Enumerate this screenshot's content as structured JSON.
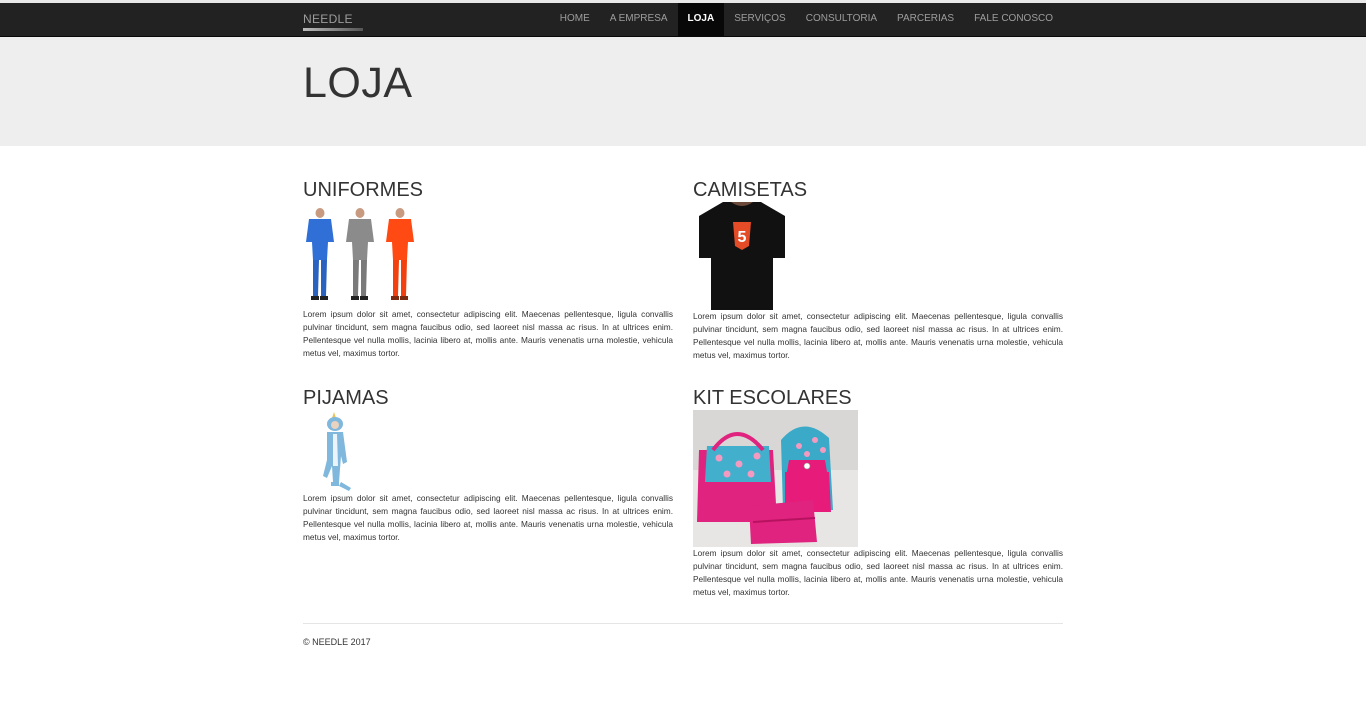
{
  "colors": {
    "navbar_bg": "#222222",
    "active_bg": "#080808",
    "jumbotron_bg": "#eeeeee"
  },
  "brand": "NEEDLE",
  "nav": [
    {
      "label": "HOME",
      "active": false
    },
    {
      "label": "A EMPRESA",
      "active": false
    },
    {
      "label": "LOJA",
      "active": true
    },
    {
      "label": "SERVIÇOS",
      "active": false
    },
    {
      "label": "CONSULTORIA",
      "active": false
    },
    {
      "label": "PARCERIAS",
      "active": false
    },
    {
      "label": "FALE CONOSCO",
      "active": false
    }
  ],
  "page": {
    "title": "LOJA"
  },
  "products": [
    {
      "title": "UNIFORMES",
      "image": "uniforms-photo",
      "text": "Lorem ipsum dolor sit amet, consectetur adipiscing elit. Maecenas pellentesque, ligula convallis pulvinar tincidunt, sem magna faucibus odio, sed laoreet nisl massa ac risus. In at ultrices enim. Pellentesque vel nulla mollis, lacinia libero at, mollis ante. Mauris venenatis urna molestie, vehicula metus vel, maximus tortor."
    },
    {
      "title": "CAMISETAS",
      "image": "tshirt-photo",
      "text": "Lorem ipsum dolor sit amet, consectetur adipiscing elit. Maecenas pellentesque, ligula convallis pulvinar tincidunt, sem magna faucibus odio, sed laoreet nisl massa ac risus. In at ultrices enim. Pellentesque vel nulla mollis, lacinia libero at, mollis ante. Mauris venenatis urna molestie, vehicula metus vel, maximus tortor."
    },
    {
      "title": "PIJAMAS",
      "image": "pajama-photo",
      "text": "Lorem ipsum dolor sit amet, consectetur adipiscing elit. Maecenas pellentesque, ligula convallis pulvinar tincidunt, sem magna faucibus odio, sed laoreet nisl massa ac risus. In at ultrices enim. Pellentesque vel nulla mollis, lacinia libero at, mollis ante. Mauris venenatis urna molestie, vehicula metus vel, maximus tortor."
    },
    {
      "title": "KIT ESCOLARES",
      "image": "school-kit-photo",
      "text": "Lorem ipsum dolor sit amet, consectetur adipiscing elit. Maecenas pellentesque, ligula convallis pulvinar tincidunt, sem magna faucibus odio, sed laoreet nisl massa ac risus. In at ultrices enim. Pellentesque vel nulla mollis, lacinia libero at, mollis ante. Mauris venenatis urna molestie, vehicula metus vel, maximus tortor."
    }
  ],
  "footer": {
    "text": "© NEEDLE 2017"
  }
}
